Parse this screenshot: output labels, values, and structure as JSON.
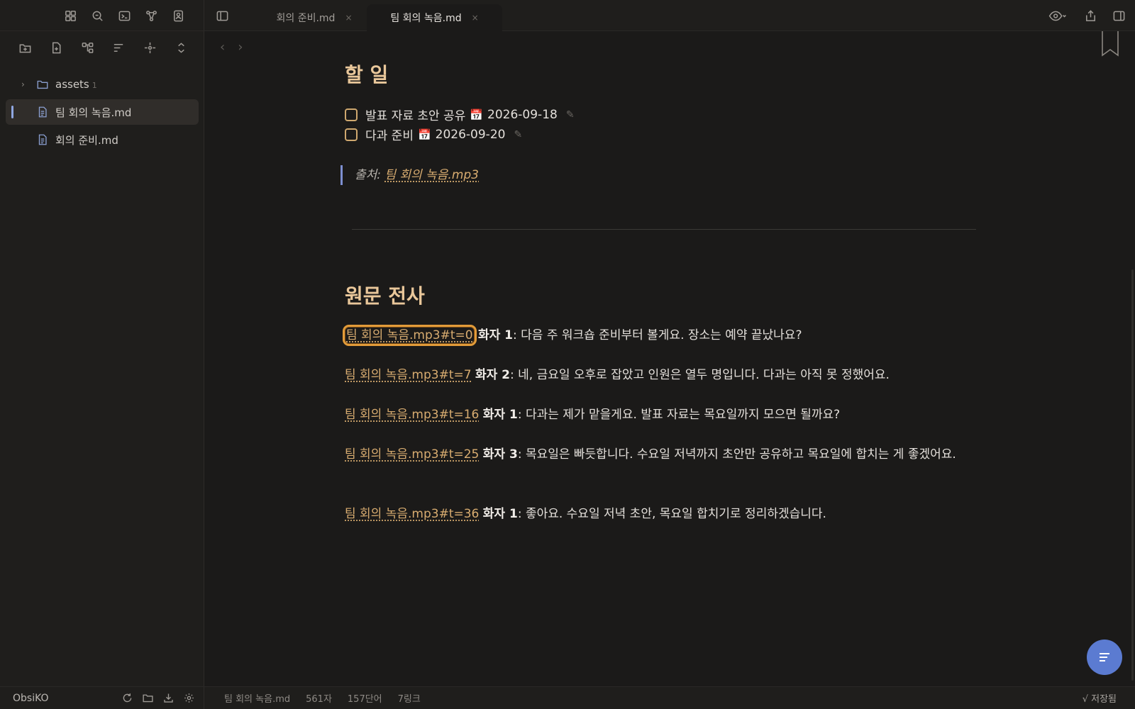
{
  "sidebar": {
    "ribbon_icons": [
      "grid-icon",
      "search-icon",
      "terminal-icon",
      "graph-icon",
      "contact-icon"
    ],
    "file_toolbar_icons": [
      "new-folder-icon",
      "new-note-icon",
      "tree-icon",
      "sort-icon",
      "focus-icon",
      "collapse-icon"
    ],
    "tree": [
      {
        "label": "assets",
        "type": "folder",
        "count": "1"
      },
      {
        "label": "팀 회의 녹음.md",
        "type": "file",
        "active": true
      },
      {
        "label": "회의 준비.md",
        "type": "file"
      }
    ],
    "vault_name": "ObsiKO"
  },
  "tabs": [
    {
      "label": "회의 준비.md",
      "close": "×"
    },
    {
      "label": "팀 회의 녹음.md",
      "close": "×"
    }
  ],
  "content": {
    "faint_top": "",
    "todo_heading": "할 일",
    "tasks": [
      {
        "text": "발표 자료 초안 공유",
        "date": "2026-09-18"
      },
      {
        "text": "다과 준비",
        "date": "2026-09-20"
      }
    ],
    "quote_prefix": "출처:",
    "quote_link": "팀 회의 녹음.mp3",
    "transcript_heading": "원문 전사",
    "transcript": [
      {
        "link": "팀 회의 녹음.mp3#t=0",
        "speaker": "화자 1",
        "text": ": 다음 주 워크숍 준비부터 볼게요. 장소는 예약 끝났나요?"
      },
      {
        "link": "팀 회의 녹음.mp3#t=7",
        "speaker": "화자 2",
        "text": ": 네, 금요일 오후로 잡았고 인원은 열두 명입니다. 다과는 아직 못 정했어요."
      },
      {
        "link": "팀 회의 녹음.mp3#t=16",
        "speaker": "화자 1",
        "text": ": 다과는 제가 맡을게요. 발표 자료는 목요일까지 모으면 될까요?"
      },
      {
        "link": "팀 회의 녹음.mp3#t=25",
        "speaker": "화자 3",
        "text": ": 목요일은 빠듯합니다. 수요일 저녁까지 초안만 공유하고 목요일에 합치는 게 좋겠어요."
      },
      {
        "link": "팀 회의 녹음.mp3#t=36",
        "speaker": "화자 1",
        "text": ": 좋아요. 수요일 저녁 초안, 목요일 합치기로 정리하겠습니다."
      }
    ]
  },
  "status": {
    "filename": "팀 회의 녹음.md",
    "chars": "561자",
    "words": "157단어",
    "links": "7링크",
    "saved": "√ 저장됨"
  },
  "colors": {
    "accent": "#e9c79a",
    "link": "#d8ac70",
    "focus_outline": "#e29b39",
    "fab": "#5b7bd1"
  }
}
